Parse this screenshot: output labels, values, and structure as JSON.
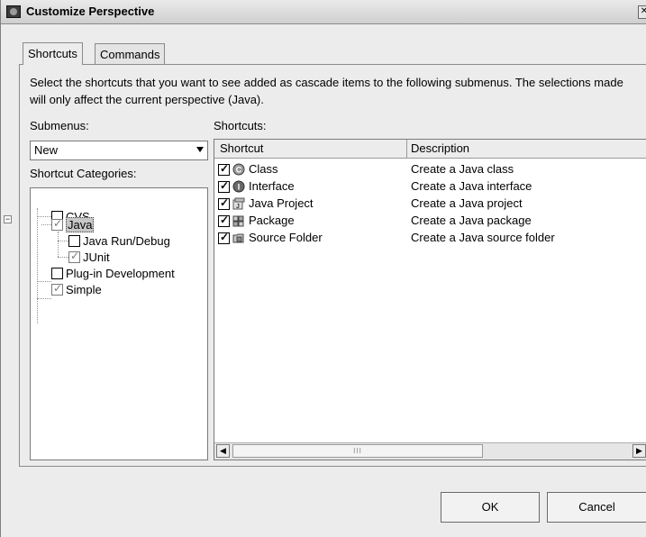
{
  "window": {
    "title": "Customize Perspective"
  },
  "tabs": [
    {
      "label": "Shortcuts",
      "active": true
    },
    {
      "label": "Commands",
      "active": false
    }
  ],
  "description": "Select the shortcuts that you want to see added as cascade items to the following submenus.  The selections made will only affect the current perspective (Java).",
  "submenus": {
    "label": "Submenus:",
    "selected": "New"
  },
  "categories": {
    "label": "Shortcut Categories:",
    "items": [
      {
        "label": "CVS",
        "state": "unchecked"
      },
      {
        "label": "Java",
        "state": "grayed",
        "expanded": true,
        "selected": true
      },
      {
        "label": "Java Run/Debug",
        "state": "unchecked"
      },
      {
        "label": "JUnit",
        "state": "grayed"
      },
      {
        "label": "Plug-in Development",
        "state": "unchecked"
      },
      {
        "label": "Simple",
        "state": "grayed"
      }
    ]
  },
  "shortcuts": {
    "label": "Shortcuts:",
    "columns": [
      "Shortcut",
      "Description"
    ],
    "rows": [
      {
        "name": "Class",
        "description": "Create a Java class",
        "checked": true,
        "icon": "class-icon"
      },
      {
        "name": "Interface",
        "description": "Create a Java interface",
        "checked": true,
        "icon": "interface-icon"
      },
      {
        "name": "Java Project",
        "description": "Create a Java project",
        "checked": true,
        "icon": "java-project-icon"
      },
      {
        "name": "Package",
        "description": "Create a Java package",
        "checked": true,
        "icon": "package-icon"
      },
      {
        "name": "Source Folder",
        "description": "Create a Java source folder",
        "checked": true,
        "icon": "source-folder-icon"
      }
    ]
  },
  "scrollbar": {
    "thumb_grip": "III"
  },
  "buttons": {
    "ok": "OK",
    "cancel": "Cancel"
  }
}
